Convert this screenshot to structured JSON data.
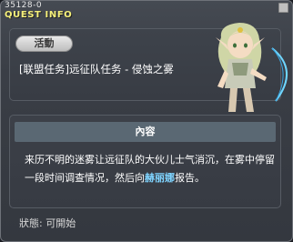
{
  "window": {
    "quest_id": "35128-0",
    "title": "QUEST INFO"
  },
  "quest": {
    "category_tag": "活動",
    "name": "[联盟任务]远征队任务 - 侵蚀之雾"
  },
  "content": {
    "header": "內容",
    "text_before": "来历不明的迷雾让远征队的大伙儿士气消沉，在雾中停留一段时间调查情况，然后向",
    "npc_name": "赫丽娜",
    "text_after": "报告。"
  },
  "status": {
    "text": "狀態:  可開始"
  },
  "colors": {
    "title": "#f5f07a",
    "npc_link": "#7fd4ff",
    "header_bar": "#5a6873"
  }
}
